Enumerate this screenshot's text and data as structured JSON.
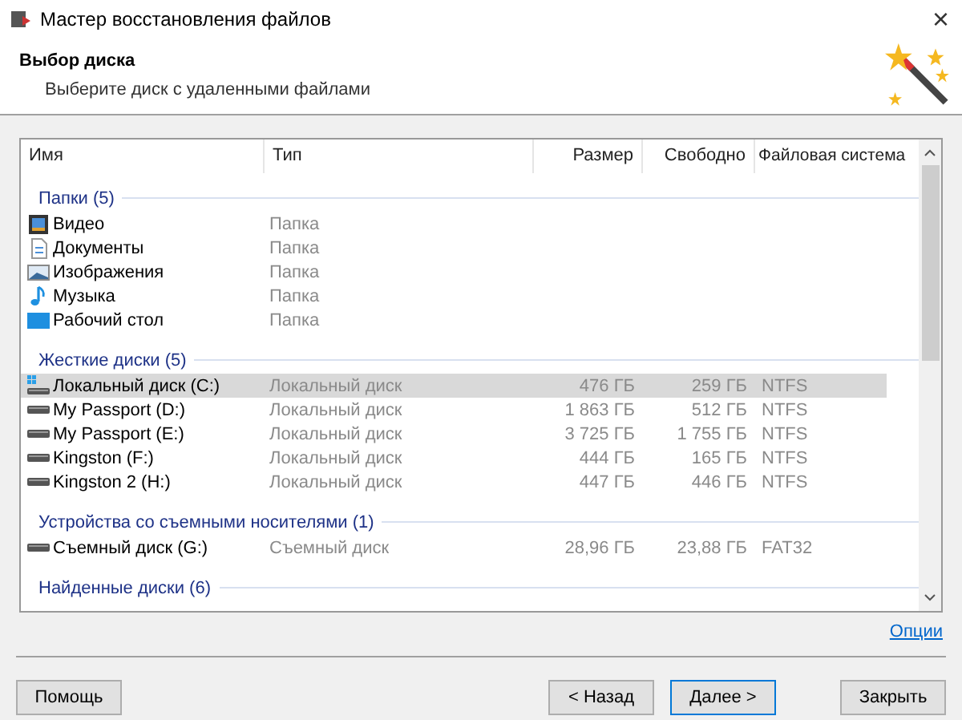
{
  "window": {
    "title": "Мастер восстановления файлов",
    "close": "×"
  },
  "header": {
    "title": "Выбор диска",
    "subtitle": "Выберите диск с удаленными файлами"
  },
  "table": {
    "columns": [
      "Имя",
      "Тип",
      "Размер",
      "Свободно",
      "Файловая система"
    ],
    "groups": [
      {
        "title": "Папки (5)",
        "rows": [
          {
            "kind": "video",
            "name": "Видео",
            "type": "Папка",
            "selected": false
          },
          {
            "kind": "documents",
            "name": "Документы",
            "type": "Папка",
            "selected": false
          },
          {
            "kind": "images",
            "name": "Изображения",
            "type": "Папка",
            "selected": false
          },
          {
            "kind": "music",
            "name": "Музыка",
            "type": "Папка",
            "selected": false
          },
          {
            "kind": "desktop",
            "name": "Рабочий стол",
            "type": "Папка",
            "selected": false
          }
        ]
      },
      {
        "title": "Жесткие диски (5)",
        "rows": [
          {
            "kind": "system-drive",
            "name": "Локальный диск (C:)",
            "type": "Локальный диск",
            "size": "476 ГБ",
            "free": "259 ГБ",
            "fs": "NTFS",
            "selected": true
          },
          {
            "kind": "drive",
            "name": "My Passport (D:)",
            "type": "Локальный диск",
            "size": "1 863 ГБ",
            "free": "512 ГБ",
            "fs": "NTFS",
            "selected": false
          },
          {
            "kind": "drive",
            "name": "My Passport (E:)",
            "type": "Локальный диск",
            "size": "3 725 ГБ",
            "free": "1 755 ГБ",
            "fs": "NTFS",
            "selected": false
          },
          {
            "kind": "drive",
            "name": "Kingston (F:)",
            "type": "Локальный диск",
            "size": "444 ГБ",
            "free": "165 ГБ",
            "fs": "NTFS",
            "selected": false
          },
          {
            "kind": "drive",
            "name": "Kingston 2 (H:)",
            "type": "Локальный диск",
            "size": "447 ГБ",
            "free": "446 ГБ",
            "fs": "NTFS",
            "selected": false
          }
        ]
      },
      {
        "title": "Устройства со съемными носителями (1)",
        "rows": [
          {
            "kind": "drive",
            "name": "Съемный диск (G:)",
            "type": "Съемный диск",
            "size": "28,96 ГБ",
            "free": "23,88 ГБ",
            "fs": "FAT32",
            "selected": false
          }
        ]
      },
      {
        "title": "Найденные диски (6)"
      }
    ]
  },
  "options_link": "Опции",
  "buttons": {
    "help": "Помощь",
    "back": "< Назад",
    "next": "Далее >",
    "close": "Закрыть"
  }
}
